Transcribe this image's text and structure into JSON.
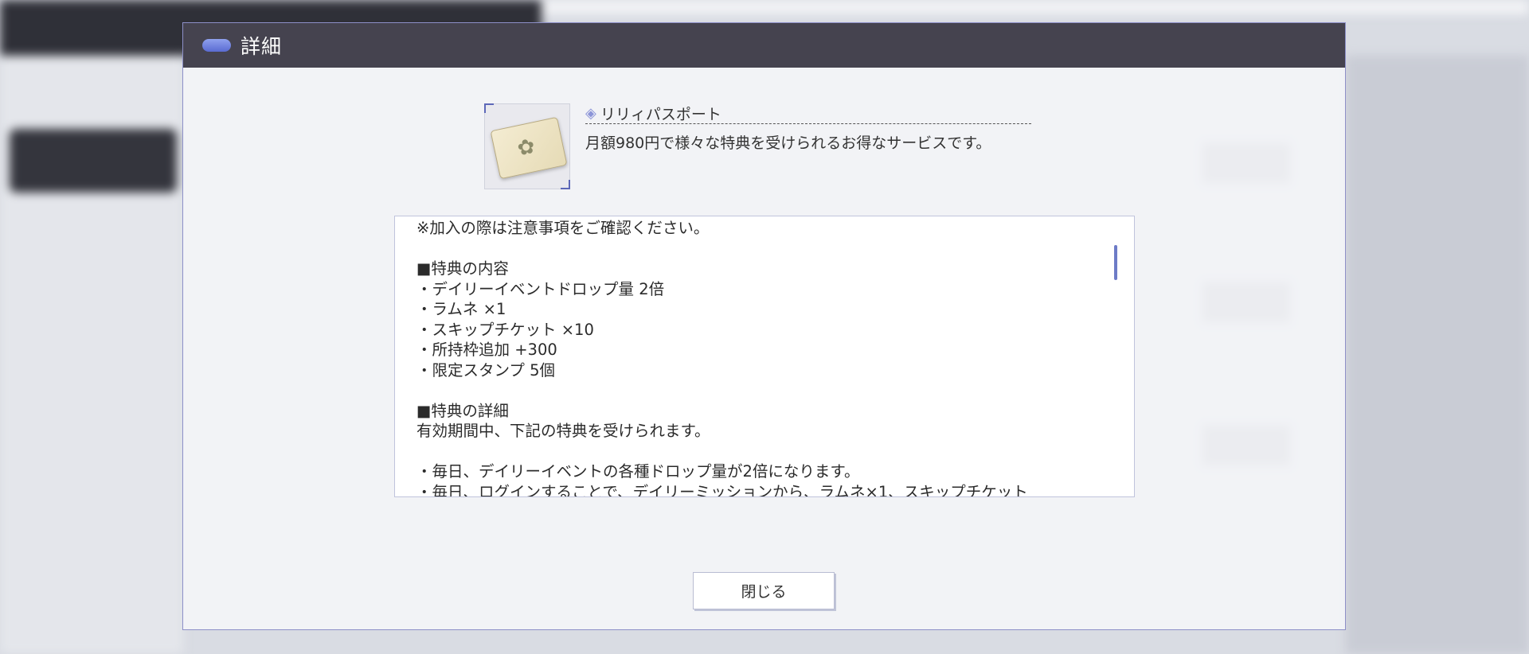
{
  "dialog": {
    "title": "詳細",
    "header_icon": "pill-icon",
    "close_label": "閉じる"
  },
  "item": {
    "icon": "diamond-icon",
    "name": "リリィパスポート",
    "description": "月額980円で様々な特典を受けられるお得なサービスです。"
  },
  "details": {
    "cut_top": "　　　　　　　　　　　　　　　　　　　　　　",
    "lines": [
      "※加入の際は注意事項をご確認ください。",
      "",
      "■特典の内容",
      "・デイリーイベントドロップ量 2倍",
      "・ラムネ ×1",
      "・スキップチケット ×10",
      "・所持枠追加 +300",
      "・限定スタンプ 5個",
      "",
      "■特典の詳細",
      "有効期間中、下記の特典を受けられます。",
      "",
      "・毎日、デイリーイベントの各種ドロップ量が2倍になります。",
      "・毎日、ログインすることで、デイリーミッションから、ラムネ×1、スキップチケット"
    ]
  },
  "colors": {
    "header_bg": "#45434f",
    "accent": "#6d7bc7",
    "dialog_border": "#8d90c8"
  }
}
